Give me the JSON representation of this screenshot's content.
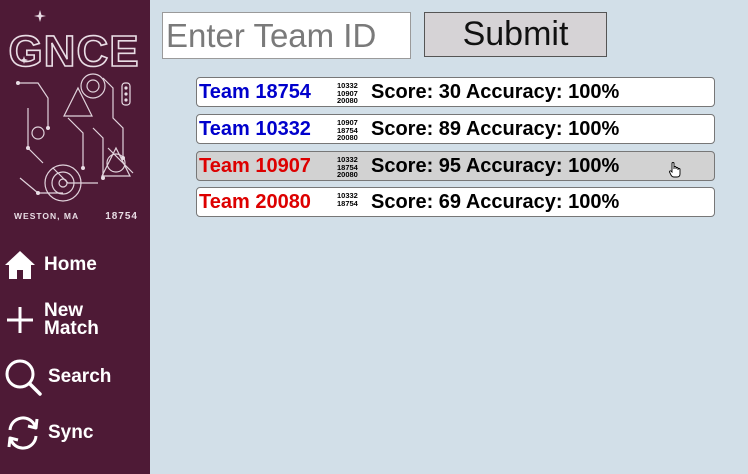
{
  "logo": {
    "title": "GNCE",
    "location": "WESTON, MA",
    "team_number": "18754"
  },
  "nav": {
    "home": "Home",
    "new_match_line1": "New",
    "new_match_line2": "Match",
    "search": "Search",
    "sync": "Sync"
  },
  "form": {
    "placeholder": "Enter Team ID",
    "value": "",
    "submit_label": "Submit"
  },
  "results": [
    {
      "team": "Team 18754",
      "partners": [
        "10332",
        "10907",
        "20080"
      ],
      "stats": "Score: 30 Accuracy: 100%",
      "color": "#0000cc",
      "hover": false
    },
    {
      "team": "Team 10332",
      "partners": [
        "10907",
        "18754",
        "20080"
      ],
      "stats": "Score: 89 Accuracy: 100%",
      "color": "#0000cc",
      "hover": false
    },
    {
      "team": "Team 10907",
      "partners": [
        "10332",
        "18754",
        "20080"
      ],
      "stats": "Score: 95 Accuracy: 100%",
      "color": "#dd0000",
      "hover": true
    },
    {
      "team": "Team 20080",
      "partners": [
        "10332",
        "18754"
      ],
      "stats": "Score: 69 Accuracy: 100%",
      "color": "#dd0000",
      "hover": false
    }
  ],
  "colors": {
    "sidebar": "#4e1a36",
    "background": "#d2dfe8",
    "blue_alliance": "#0000cc",
    "red_alliance": "#dd0000"
  },
  "icons": {
    "home": "home-icon",
    "new_match": "plus-icon",
    "search": "search-icon",
    "sync": "sync-icon"
  }
}
